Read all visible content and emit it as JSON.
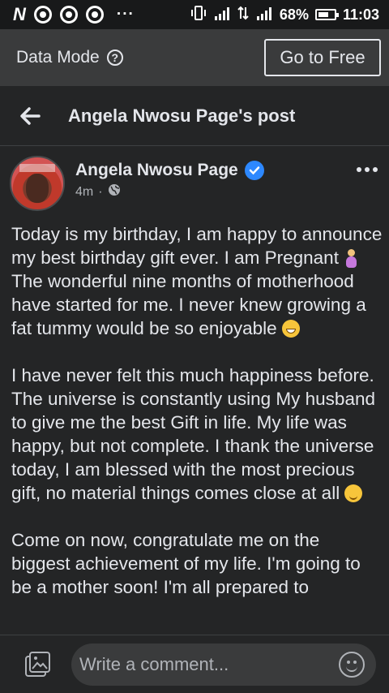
{
  "status_bar": {
    "carrier_icon": "N",
    "notification_icons": [
      "chrome-icon",
      "chrome-icon",
      "chrome-icon"
    ],
    "more": "···",
    "battery_percent": "68%",
    "battery_level": 0.68,
    "time": "11:03"
  },
  "data_mode": {
    "label": "Data Mode",
    "info_icon": "?",
    "button_label": "Go to Free"
  },
  "header": {
    "title": "Angela Nwosu Page's post"
  },
  "post": {
    "author": "Angela Nwosu Page",
    "verified": true,
    "time": "4m",
    "separator": "·",
    "audience_icon": "globe-icon",
    "paragraphs": [
      {
        "text": "Today is my birthday, I am happy to announce my best birthday gift ever. I am Pregnant ",
        "emoji1": "pregnant-woman",
        "text2": " The wonderful nine months of motherhood have started for me. I never knew growing a fat tummy would be so enjoyable ",
        "emoji2": "grinning-face"
      },
      {
        "text": "I have never felt this much happiness before. The universe is constantly using My husband to give me the best Gift in life. My life was happy, but not complete. I thank the universe today, I am blessed with the most precious gift, no material things comes close at all ",
        "emoji": "smiling-face"
      },
      {
        "text": "Come on now, congratulate me on the biggest achievement of my life. I'm going to be a mother soon! I'm all prepared to"
      }
    ]
  },
  "comment": {
    "placeholder": "Write a comment..."
  },
  "colors": {
    "background": "#242526",
    "bar": "#3a3b3c",
    "verified": "#2d88ff",
    "text": "#e4e6eb",
    "muted": "#b0b3b8"
  }
}
